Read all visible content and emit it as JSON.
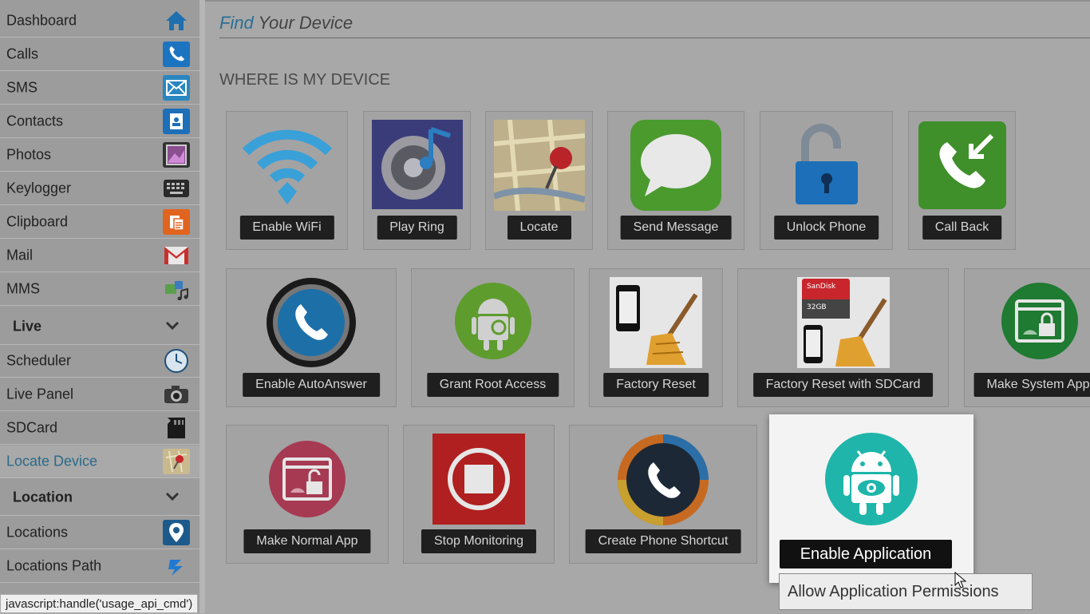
{
  "sidebar": {
    "items": [
      {
        "label": "Dashboard",
        "icon": "home-icon"
      },
      {
        "label": "Calls",
        "icon": "phone-icon"
      },
      {
        "label": "SMS",
        "icon": "envelope-icon"
      },
      {
        "label": "Contacts",
        "icon": "contact-card-icon"
      },
      {
        "label": "Photos",
        "icon": "photo-icon"
      },
      {
        "label": "Keylogger",
        "icon": "keyboard-icon"
      },
      {
        "label": "Clipboard",
        "icon": "clipboard-icon"
      },
      {
        "label": "Mail",
        "icon": "gmail-icon"
      },
      {
        "label": "MMS",
        "icon": "mms-icon"
      }
    ],
    "group_live": "Live",
    "live_items": [
      {
        "label": "Scheduler",
        "icon": "clock-icon"
      },
      {
        "label": "Live Panel",
        "icon": "camera-icon"
      },
      {
        "label": "SDCard",
        "icon": "sdcard-icon"
      },
      {
        "label": "Locate Device",
        "icon": "map-pin-icon",
        "active": true
      }
    ],
    "group_location": "Location",
    "location_items": [
      {
        "label": "Locations",
        "icon": "location-pin-icon"
      },
      {
        "label": "Locations Path",
        "icon": "path-arrow-icon"
      }
    ]
  },
  "header": {
    "title_accent": "Find",
    "title_rest": "Your Device",
    "section": "WHERE IS MY DEVICE"
  },
  "actions": [
    {
      "label": "Enable WiFi",
      "icon": "wifi-icon"
    },
    {
      "label": "Play Ring",
      "icon": "speaker-icon"
    },
    {
      "label": "Locate",
      "icon": "map-pin-icon"
    },
    {
      "label": "Send Message",
      "icon": "message-bubble-icon"
    },
    {
      "label": "Unlock Phone",
      "icon": "padlock-open-icon"
    },
    {
      "label": "Call Back",
      "icon": "call-back-icon"
    },
    {
      "label": "Enable AutoAnswer",
      "icon": "auto-answer-phone-icon"
    },
    {
      "label": "Grant Root Access",
      "icon": "android-gear-icon"
    },
    {
      "label": "Factory Reset",
      "icon": "phone-broom-icon"
    },
    {
      "label": "Factory Reset with SDCard",
      "icon": "sdcard-broom-icon"
    },
    {
      "label": "Make System App",
      "icon": "android-lock-icon"
    },
    {
      "label": "Make Normal App",
      "icon": "android-unlock-icon"
    },
    {
      "label": "Stop Monitoring",
      "icon": "stop-icon"
    },
    {
      "label": "Create Phone Shortcut",
      "icon": "phone-shortcut-icon"
    },
    {
      "label": "Enable Application",
      "icon": "android-eye-icon"
    }
  ],
  "tooltip": "Allow Application Permissions",
  "status_bar": "javascript:handle('usage_api_cmd')",
  "colors": {
    "accent_blue": "#2b6f93",
    "button_dark": "#1f1f1f",
    "overlay_gray": "#a8a8a8",
    "teal": "#1fb5aa"
  }
}
